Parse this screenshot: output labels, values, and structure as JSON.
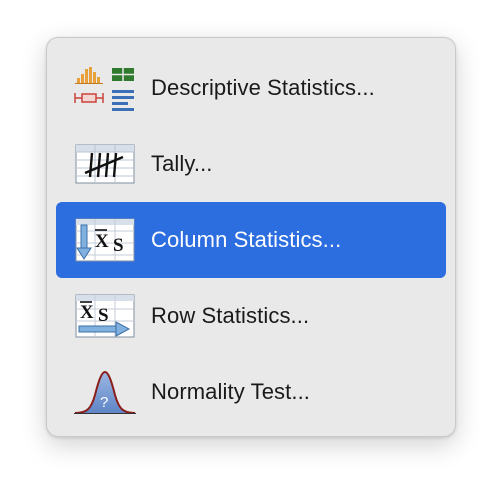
{
  "menu": {
    "selected_index": 2,
    "items": [
      {
        "label": "Descriptive Statistics...",
        "icon": "descriptive-statistics-icon"
      },
      {
        "label": "Tally...",
        "icon": "tally-icon"
      },
      {
        "label": "Column Statistics...",
        "icon": "column-statistics-icon"
      },
      {
        "label": "Row Statistics...",
        "icon": "row-statistics-icon"
      },
      {
        "label": "Normality Test...",
        "icon": "normality-test-icon"
      }
    ]
  },
  "colors": {
    "menu_background": "#e9e9e9",
    "selection": "#2c6ee0",
    "text": "#1a1a1a",
    "selected_text": "#ffffff"
  }
}
